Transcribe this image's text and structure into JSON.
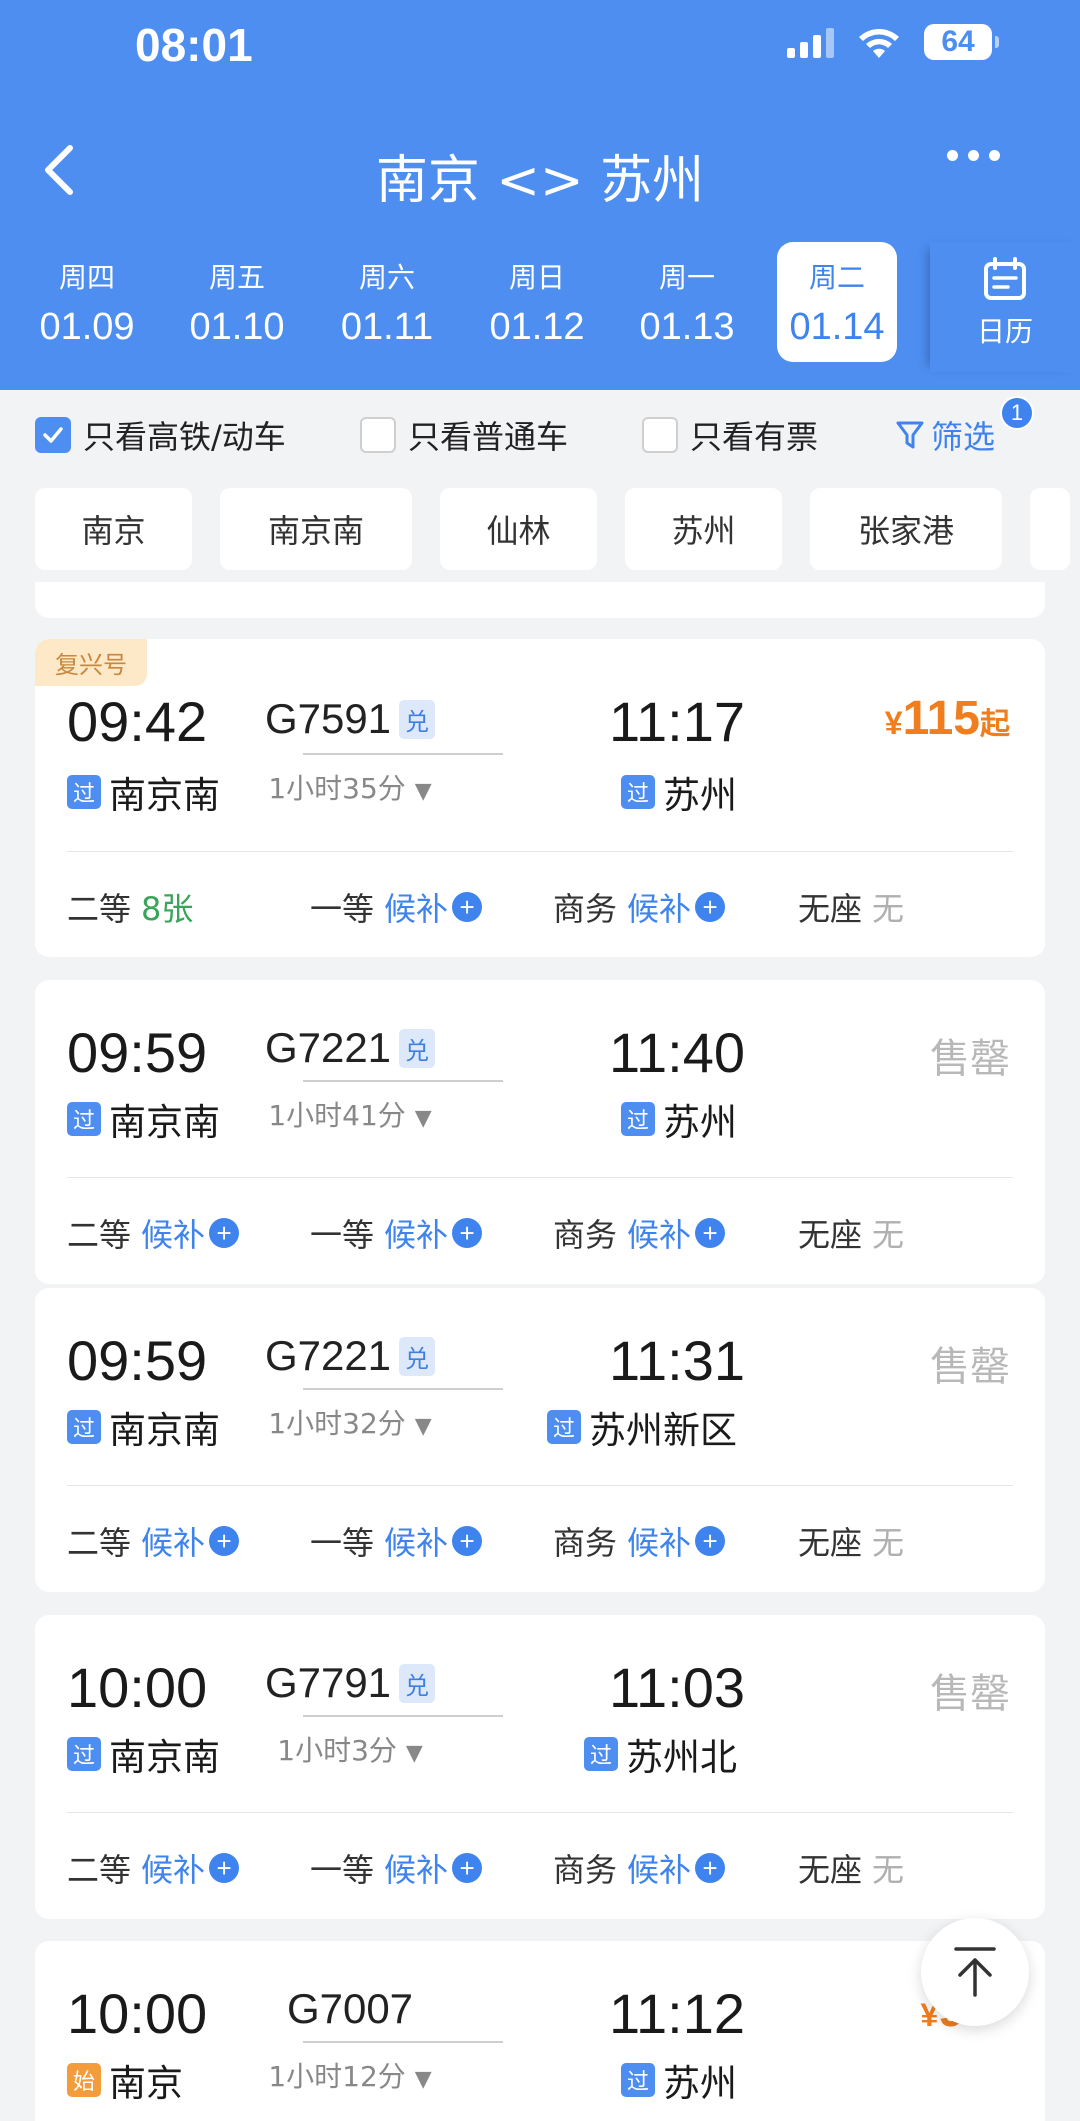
{
  "status_bar": {
    "time": "08:01",
    "battery": "64"
  },
  "header": {
    "title": "南京 <> 苏州"
  },
  "dates": [
    {
      "weekday": "周四",
      "date": "01.09"
    },
    {
      "weekday": "周五",
      "date": "01.10"
    },
    {
      "weekday": "周六",
      "date": "01.11"
    },
    {
      "weekday": "周日",
      "date": "01.12"
    },
    {
      "weekday": "周一",
      "date": "01.13"
    },
    {
      "weekday": "周二",
      "date": "01.14",
      "active": true
    }
  ],
  "calendar_label": "日历",
  "filters": {
    "high_speed_only": "只看高铁/动车",
    "normal_only": "只看普通车",
    "available_only": "只看有票",
    "screen": "筛选",
    "screen_count": "1"
  },
  "stations": [
    "南京",
    "南京南",
    "仙林",
    "苏州",
    "张家港"
  ],
  "trains": [
    {
      "tag": "复兴号",
      "depart_time": "09:42",
      "depart_station": "南京南",
      "depart_badge": "过",
      "train_no": "G7591",
      "exchange": "兑",
      "duration": "1小时35分",
      "arrive_time": "11:17",
      "arrive_station": "苏州",
      "arrive_badge": "过",
      "price_symbol": "¥",
      "price": "115",
      "price_suffix": "起",
      "seats": [
        {
          "label": "二等",
          "status": "8张",
          "kind": "avail"
        },
        {
          "label": "一等",
          "status": "候补",
          "kind": "wait"
        },
        {
          "label": "商务",
          "status": "候补",
          "kind": "wait"
        },
        {
          "label": "无座",
          "status": "无",
          "kind": "none"
        }
      ]
    },
    {
      "depart_time": "09:59",
      "depart_station": "南京南",
      "depart_badge": "过",
      "train_no": "G7221",
      "exchange": "兑",
      "duration": "1小时41分",
      "arrive_time": "11:40",
      "arrive_station": "苏州",
      "arrive_badge": "过",
      "status": "售罄",
      "seats": [
        {
          "label": "二等",
          "status": "候补",
          "kind": "wait"
        },
        {
          "label": "一等",
          "status": "候补",
          "kind": "wait"
        },
        {
          "label": "商务",
          "status": "候补",
          "kind": "wait"
        },
        {
          "label": "无座",
          "status": "无",
          "kind": "none"
        }
      ]
    },
    {
      "depart_time": "09:59",
      "depart_station": "南京南",
      "depart_badge": "过",
      "train_no": "G7221",
      "exchange": "兑",
      "duration": "1小时32分",
      "arrive_time": "11:31",
      "arrive_station": "苏州新区",
      "arrive_badge": "过",
      "status": "售罄",
      "seats": [
        {
          "label": "二等",
          "status": "候补",
          "kind": "wait"
        },
        {
          "label": "一等",
          "status": "候补",
          "kind": "wait"
        },
        {
          "label": "商务",
          "status": "候补",
          "kind": "wait"
        },
        {
          "label": "无座",
          "status": "无",
          "kind": "none"
        }
      ]
    },
    {
      "depart_time": "10:00",
      "depart_station": "南京南",
      "depart_badge": "过",
      "train_no": "G7791",
      "exchange": "兑",
      "duration": "1小时3分",
      "arrive_time": "11:03",
      "arrive_station": "苏州北",
      "arrive_badge": "过",
      "status": "售罄",
      "seats": [
        {
          "label": "二等",
          "status": "候补",
          "kind": "wait"
        },
        {
          "label": "一等",
          "status": "候补",
          "kind": "wait"
        },
        {
          "label": "商务",
          "status": "候补",
          "kind": "wait"
        },
        {
          "label": "无座",
          "status": "无",
          "kind": "none"
        }
      ]
    },
    {
      "depart_time": "10:00",
      "depart_station": "南京",
      "depart_badge": "始",
      "train_no": "G7007",
      "duration": "1小时12分",
      "arrive_time": "11:12",
      "arrive_station": "苏州",
      "arrive_badge": "过",
      "price_symbol": "¥",
      "price": "9"
    }
  ],
  "colors": {
    "header_blue": "#4d8ef0",
    "price_orange": "#f07d1e",
    "available_green": "#3aa55a",
    "wait_blue": "#3f84ee"
  }
}
